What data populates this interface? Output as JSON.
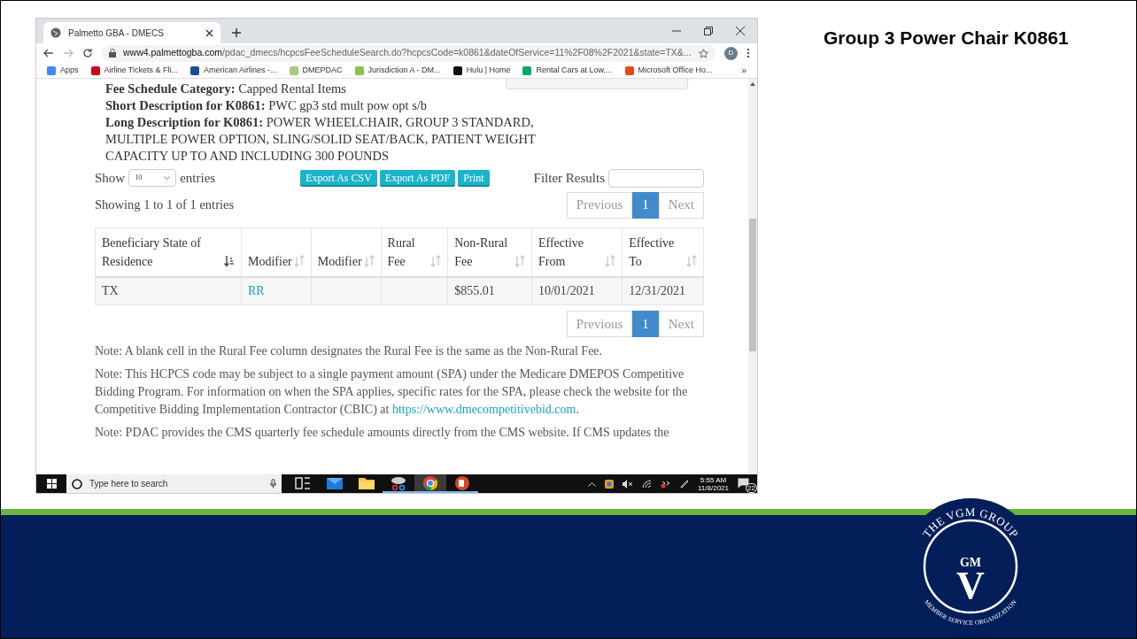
{
  "slide": {
    "title": "Group 3 Power Chair K0861",
    "logo": {
      "top_text": "THE VGM GROUP",
      "bottom_text": "MEMBER SERVICE ORGANIZATION",
      "monogram_top": "GM",
      "monogram_main": "V"
    }
  },
  "browser": {
    "tab_title": "Palmetto GBA - DMECS",
    "url_host": "www4.palmettogba.com",
    "url_path": "/pdac_dmecs/hcpcsFeeScheduleSearch.do?hcpcsCode=k0861&dateOfService=11%2F08%2F2021&state=TX&...",
    "profile": "D",
    "bookmarks": [
      {
        "label": "Apps",
        "color": "#4285f4"
      },
      {
        "label": "Airline Tickets & Fli...",
        "color": "#d0021b"
      },
      {
        "label": "American Airlines -...",
        "color": "#1a4c9c"
      },
      {
        "label": "DMEPDAC",
        "color": "#a8c97f"
      },
      {
        "label": "Jurisdiction A - DM...",
        "color": "#8bc34a"
      },
      {
        "label": "Hulu | Home",
        "color": "#111111"
      },
      {
        "label": "Rental Cars at Low,...",
        "color": "#00a862"
      },
      {
        "label": "Microsoft Office Ho...",
        "color": "#e64a19"
      }
    ],
    "more": "»"
  },
  "page": {
    "details": [
      {
        "label": "Fee Schedule Category:",
        "value": "Capped Rental Items"
      },
      {
        "label": "Short Description for K0861:",
        "value": "PWC gp3 std mult pow opt s/b"
      },
      {
        "label": "Long Description for K0861:",
        "value": "POWER WHEELCHAIR, GROUP 3 STANDARD, MULTIPLE POWER OPTION, SLING/SOLID SEAT/BACK, PATIENT WEIGHT CAPACITY UP TO AND INCLUDING 300 POUNDS"
      }
    ],
    "length_menu": {
      "before": "Show",
      "value": "10",
      "after": "entries"
    },
    "export_buttons": [
      "Export As CSV",
      "Export As PDF",
      "Print"
    ],
    "filter": {
      "label": "Filter Results"
    },
    "info": "Showing 1 to 1 of 1 entries",
    "pagination_top": [
      {
        "label": "Previous",
        "selected": false
      },
      {
        "label": "1",
        "selected": true
      },
      {
        "label": "Next",
        "selected": false
      }
    ],
    "table": {
      "columns": [
        {
          "label": "Beneficiary State of Residence",
          "sorted": true
        },
        {
          "label": "Modifier",
          "sorted": false
        },
        {
          "label": "Modifier",
          "sorted": false
        },
        {
          "label": "Rural Fee",
          "sorted": false
        },
        {
          "label": "Non-Rural Fee",
          "sorted": false
        },
        {
          "label": "Effective From",
          "sorted": false
        },
        {
          "label": "Effective To",
          "sorted": false
        }
      ],
      "rows": [
        [
          {
            "text": "TX",
            "kind": "text"
          },
          {
            "text": "RR",
            "kind": "link"
          },
          {
            "kind": "empty"
          },
          {
            "kind": "empty"
          },
          {
            "text": "$855.01",
            "kind": "text"
          },
          {
            "text": "10/01/2021",
            "kind": "text"
          },
          {
            "text": "12/31/2021",
            "kind": "text"
          }
        ]
      ]
    },
    "pagination_bottom": [
      {
        "label": "Previous",
        "selected": false
      },
      {
        "label": "1",
        "selected": true
      },
      {
        "label": "Next",
        "selected": false
      }
    ],
    "notes": [
      {
        "text": "Note: A blank cell in the Rural Fee column designates the Rural Fee is the same as the Non-Rural Fee."
      },
      {
        "text": "Note: This HCPCS code may be subject to a single payment amount (SPA) under the Medicare DMEPOS Competitive Bidding Program. For information on when the SPA applies, specific rates for the SPA, please check the website for the Competitive Bidding Implementation Contractor (CBIC) at",
        "link": "https://www.dmecompetitivebid.com",
        "after": "."
      },
      {
        "text": "Note: PDAC provides the CMS quarterly fee schedule amounts directly from the CMS website. If CMS updates the"
      }
    ]
  },
  "taskbar": {
    "search_placeholder": "Type here to search",
    "apps": [
      {
        "kind": "taskview",
        "running": false,
        "selected": false
      },
      {
        "kind": "mail",
        "running": false,
        "selected": false
      },
      {
        "kind": "folder",
        "running": false,
        "selected": false
      },
      {
        "kind": "snip",
        "running": true,
        "selected": false
      },
      {
        "kind": "browser",
        "running": true,
        "selected": true
      },
      {
        "kind": "slides",
        "running": true,
        "selected": false
      }
    ],
    "time": "5:55 AM",
    "date": "11/8/2021",
    "notifications": "22"
  }
}
